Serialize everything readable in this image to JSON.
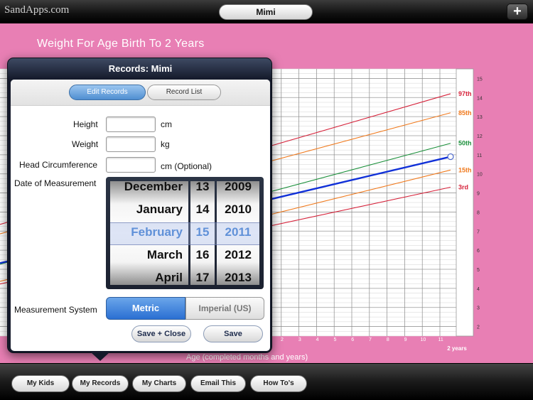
{
  "topbar": {
    "brand": "SandApps.com",
    "child_name": "Mimi",
    "add_label": "+"
  },
  "chart": {
    "title": "Weight For Age Birth To 2 Years",
    "xlabel": "Age (completed months and years)"
  },
  "chart_data": {
    "type": "line",
    "x_ticks": [
      "2",
      "3",
      "4",
      "5",
      "6",
      "7",
      "8",
      "9",
      "10",
      "11"
    ],
    "x_end_label": "2 years",
    "y_ticks": [
      2,
      3,
      4,
      5,
      6,
      7,
      8,
      9,
      10,
      11,
      12,
      13,
      14,
      15
    ],
    "xlim": [
      0,
      24
    ],
    "ylim": [
      1.5,
      15.5
    ],
    "percentile_series": [
      {
        "name": "97th",
        "color": "#d6223a",
        "points": [
          [
            8,
            11.5
          ],
          [
            23,
            14.2
          ]
        ]
      },
      {
        "name": "85th",
        "color": "#f07a1e",
        "points": [
          [
            8,
            10.7
          ],
          [
            23,
            13.2
          ]
        ]
      },
      {
        "name": "50th",
        "color": "#1a8f3a",
        "points": [
          [
            8,
            9.1
          ],
          [
            23,
            11.6
          ]
        ]
      },
      {
        "name": "15th",
        "color": "#f07a1e",
        "points": [
          [
            8,
            7.9
          ],
          [
            23,
            10.2
          ]
        ]
      },
      {
        "name": "3rd",
        "color": "#d6223a",
        "points": [
          [
            8,
            7.3
          ],
          [
            23,
            9.3
          ]
        ]
      }
    ],
    "child_series": {
      "color": "#1030d8",
      "points": [
        [
          8,
          8.7
        ],
        [
          23,
          10.9
        ]
      ]
    }
  },
  "popover": {
    "title": "Records: Mimi",
    "tabs": {
      "edit": "Edit Records",
      "list": "Record List"
    },
    "fields": {
      "height_label": "Height",
      "height_unit": "cm",
      "height_value": "",
      "weight_label": "Weight",
      "weight_unit": "kg",
      "weight_value": "",
      "head_label": "Head Circumference",
      "head_unit": "cm  (Optional)",
      "head_value": ""
    },
    "date_label": "Date of Measurement",
    "picker": {
      "months": [
        "December",
        "January",
        "February",
        "March",
        "April"
      ],
      "days": [
        "13",
        "14",
        "15",
        "16",
        "17"
      ],
      "years": [
        "2009",
        "2010",
        "2011",
        "2012",
        "2013"
      ],
      "selected_index": 2
    },
    "measurement_label": "Measurement System",
    "metric_label": "Metric",
    "imperial_label": "Imperial (US)",
    "save_close_label": "Save + Close",
    "save_label": "Save"
  },
  "bottombar": {
    "items": [
      "My Kids",
      "My Records",
      "My Charts",
      "Email This",
      "How To's"
    ]
  },
  "colors": {
    "background_pink": "#e87fb4",
    "accent_blue": "#3e7fd2"
  }
}
